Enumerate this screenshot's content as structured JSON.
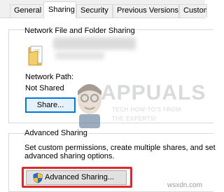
{
  "tabs": [
    {
      "label": "General",
      "active": false
    },
    {
      "label": "Sharing",
      "active": true
    },
    {
      "label": "Security",
      "active": false
    },
    {
      "label": "Previous Versions",
      "active": false
    },
    {
      "label": "Custom",
      "active": false
    }
  ],
  "network_sharing": {
    "title": "Network File and Folder Sharing",
    "network_path_label": "Network Path:",
    "status": "Not Shared",
    "share_button": "Share..."
  },
  "advanced_sharing": {
    "title": "Advanced Sharing",
    "description": [
      "Set custom permissions, create multiple shares, and set",
      "advanced sharing options."
    ],
    "button": "Advanced Sharing..."
  },
  "watermark": {
    "brand": "APPUALS",
    "tagline": [
      "TECH HOW-TO'S FROM",
      "THE EXPERTS!"
    ]
  },
  "site_mark": "wsxdn.com",
  "colors": {
    "highlight": "#e02929",
    "focus": "#0078d7",
    "window_bg": "#f0f0f0"
  },
  "icons": {
    "folder": "folder-icon",
    "shield": "uac-shield-icon"
  }
}
